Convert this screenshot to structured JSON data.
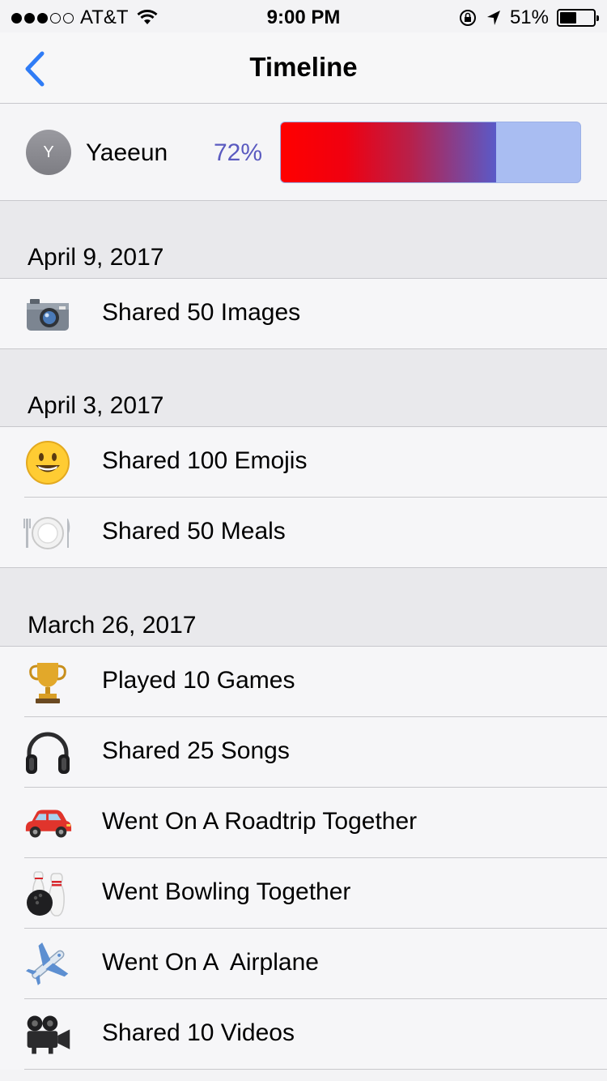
{
  "status": {
    "carrier": "AT&T",
    "time": "9:00 PM",
    "battery": "51%",
    "battery_level": 0.51
  },
  "nav": {
    "title": "Timeline",
    "back_icon": "chevron-left-icon"
  },
  "profile": {
    "avatar_initial": "Y",
    "name": "Yaeeun",
    "percent_text": "72%",
    "progress": 0.72
  },
  "sections": [
    {
      "date": "April 9, 2017",
      "items": [
        {
          "label": "Shared 50 Images",
          "icon": "camera-icon"
        }
      ]
    },
    {
      "date": "April 3, 2017",
      "items": [
        {
          "label": "Shared 100 Emojis",
          "icon": "smiley-icon"
        },
        {
          "label": "Shared 50 Meals",
          "icon": "plate-icon"
        }
      ]
    },
    {
      "date": "March 26, 2017",
      "items": [
        {
          "label": "Played 10 Games",
          "icon": "trophy-icon"
        },
        {
          "label": "Shared 25 Songs",
          "icon": "headphones-icon"
        },
        {
          "label": "Went On A Roadtrip Together",
          "icon": "car-icon"
        },
        {
          "label": "Went Bowling Together",
          "icon": "bowling-icon"
        },
        {
          "label": "Went On A  Airplane",
          "icon": "airplane-icon"
        },
        {
          "label": "Shared 10 Videos",
          "icon": "video-camera-icon"
        }
      ]
    }
  ]
}
